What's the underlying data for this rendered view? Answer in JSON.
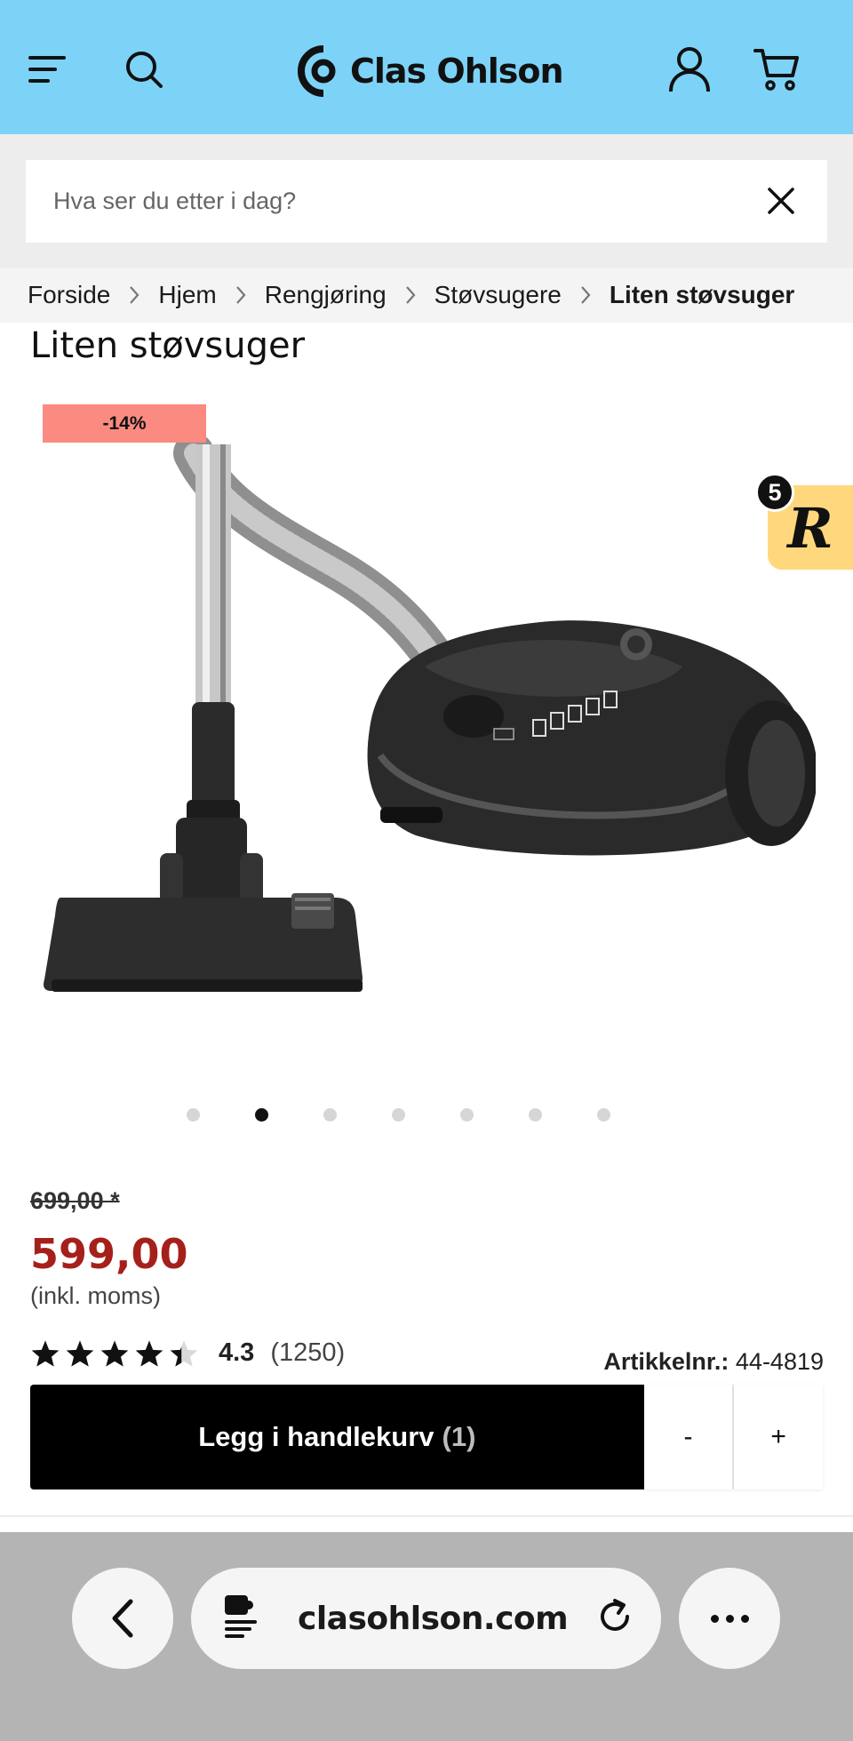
{
  "header": {
    "brand": "Clas Ohlson",
    "icons": [
      "menu-icon",
      "search-icon",
      "clas-ohlson-logo",
      "account-icon",
      "cart-icon"
    ],
    "background": "#7dd3f7"
  },
  "search": {
    "placeholder": "Hva ser du etter i dag?",
    "value": ""
  },
  "breadcrumb": {
    "items": [
      "Forside",
      "Hjem",
      "Rengjøring",
      "Støvsugere",
      "Liten støvsuger"
    ]
  },
  "product": {
    "title": "Liten støvsuger",
    "discount_badge": "-14%",
    "image_dots_total": 7,
    "image_dots_active": 2,
    "old_price": "699,00 *",
    "price": "599,00",
    "vat_note": "(inkl. moms)",
    "rating_value": "4.3",
    "rating_stars": 4.3,
    "rating_count": "(1250)",
    "article_label": "Artikkelnr.:",
    "article_number": "44-4819",
    "price_color": "#a6201b",
    "discount_color": "#fb8a80"
  },
  "cart": {
    "add_label": "Legg i handlekurv",
    "add_count": "(1)",
    "minus_label": "-",
    "plus_label": "+"
  },
  "floating_badge": {
    "count": "5",
    "letter": "R",
    "color": "#ffd87d"
  },
  "browser": {
    "url": "clasohlson.com",
    "icons": [
      "back-icon",
      "reader-icon",
      "reload-icon",
      "more-icon"
    ]
  }
}
